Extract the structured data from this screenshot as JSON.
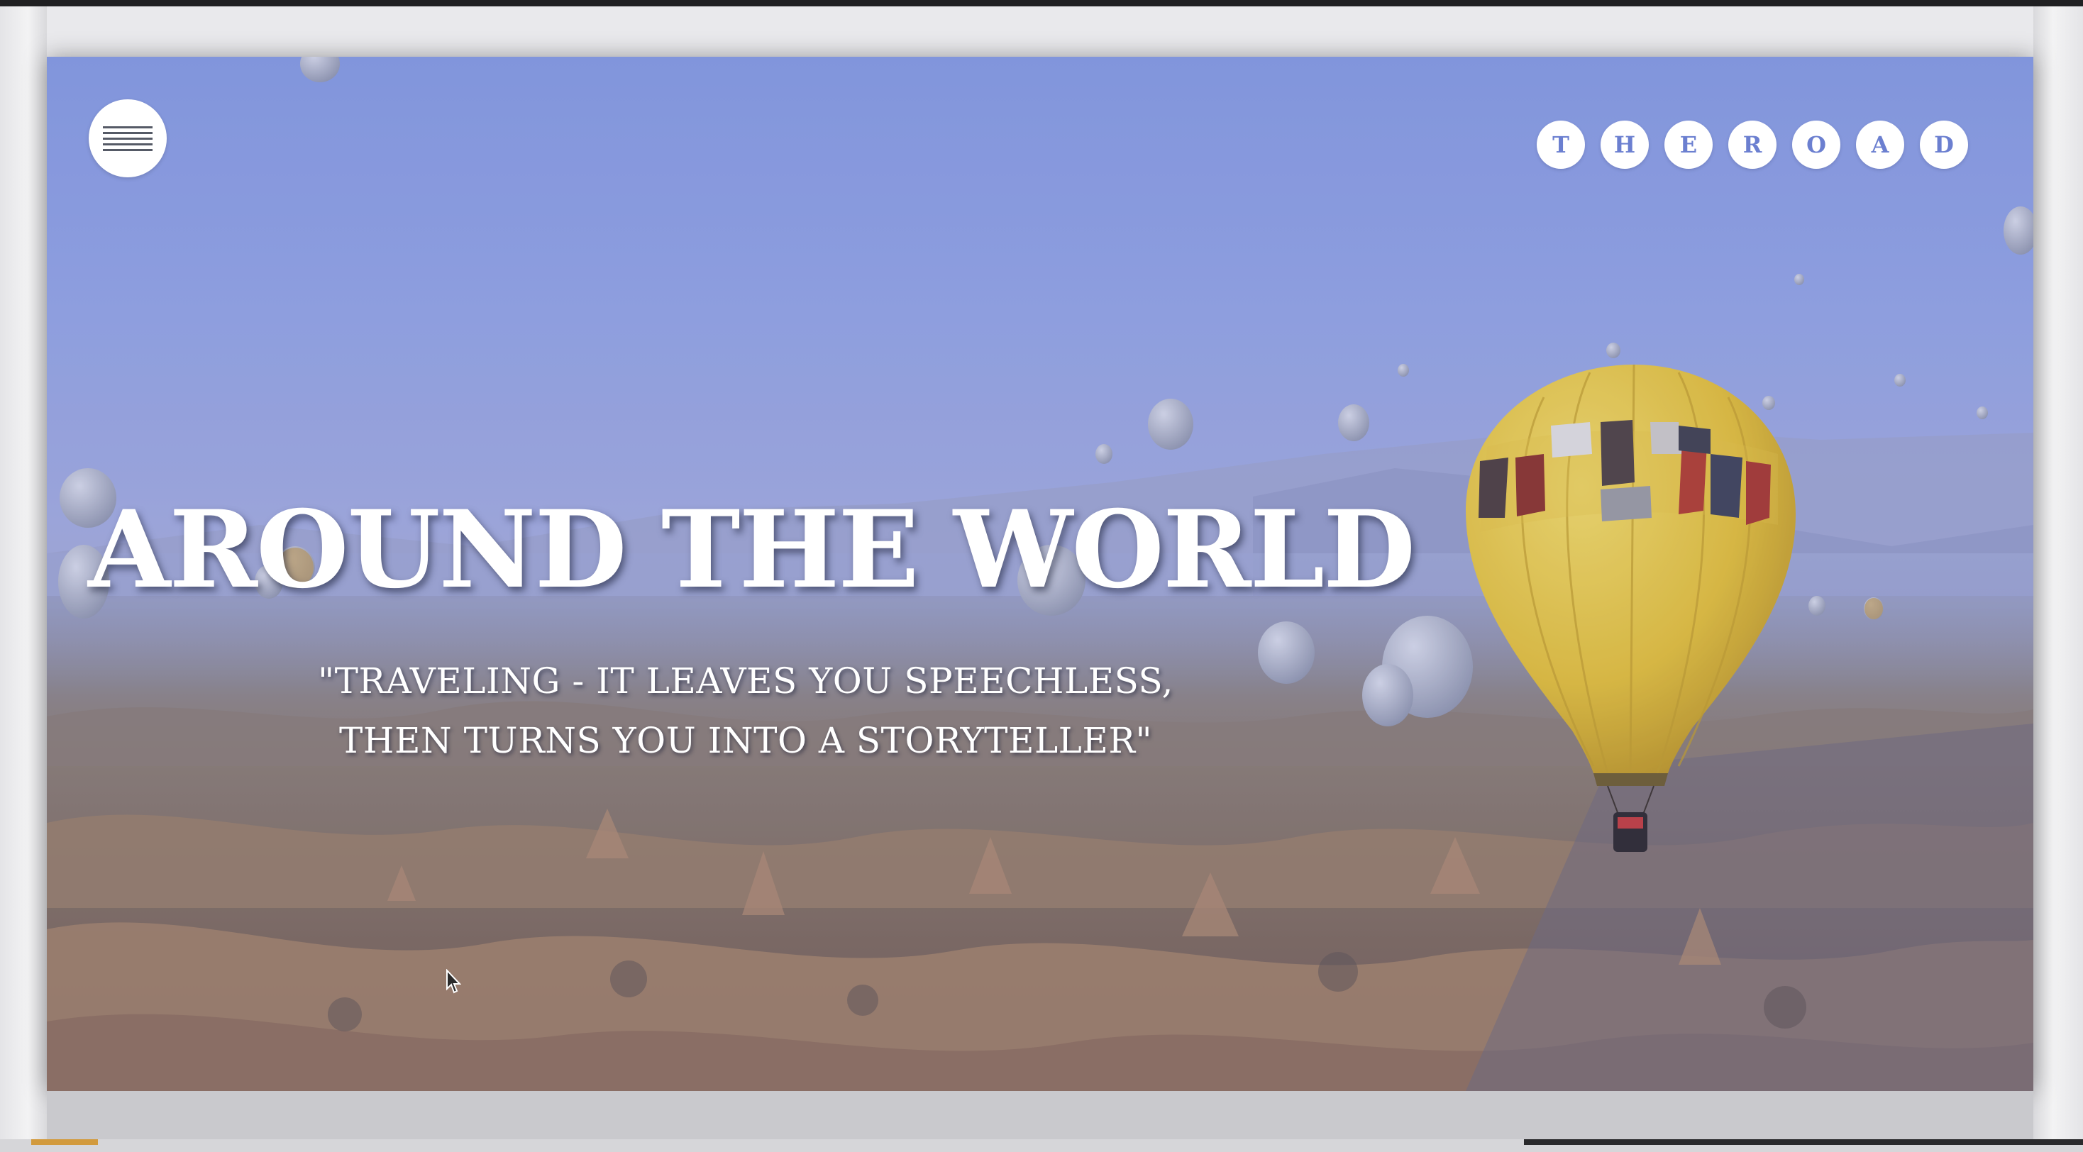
{
  "header": {
    "menu_icon": "hamburger-icon",
    "logo_letters": [
      "T",
      "H",
      "E",
      "R",
      "O",
      "A",
      "D"
    ]
  },
  "hero": {
    "title": "AROUND THE WORLD",
    "quote_line1": "\"TRAVELING - IT LEAVES YOU SPEECHLESS,",
    "quote_line2": "THEN TURNS YOU INTO A STORYTELLER\""
  },
  "colors": {
    "accent_blue": "#6b7fd0",
    "sky_blue": "#8ea0e0",
    "balloon_yellow": "#e8c23a",
    "text_white": "#ffffff"
  }
}
